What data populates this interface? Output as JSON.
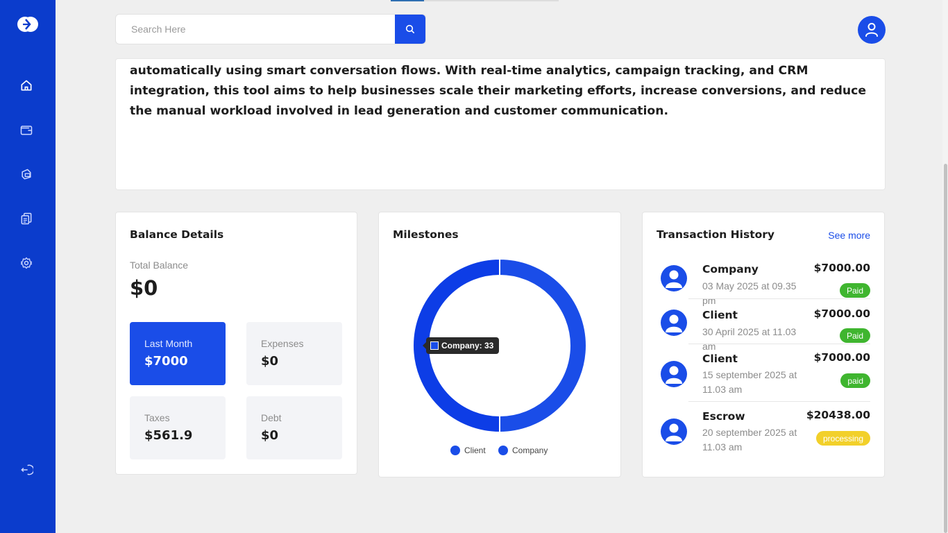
{
  "search": {
    "placeholder": "Search Here",
    "value": ""
  },
  "sidebar": {
    "items": [
      {
        "icon": "home-icon"
      },
      {
        "icon": "wallet-icon"
      },
      {
        "icon": "cards-icon"
      },
      {
        "icon": "documents-icon"
      },
      {
        "icon": "settings-icon"
      }
    ],
    "logout_icon": "logout-icon"
  },
  "description": {
    "text": "automatically using smart conversation flows. With real-time analytics, campaign tracking, and CRM integration, this tool aims to help businesses scale their marketing efforts, increase conversions, and reduce the manual workload involved in lead generation and customer communication."
  },
  "balance": {
    "title": "Balance Details",
    "total_label": "Total Balance",
    "total_value": "$0",
    "tiles": [
      {
        "label": "Last Month",
        "value": "$7000",
        "active": true
      },
      {
        "label": "Expenses",
        "value": "$0"
      },
      {
        "label": "Taxes",
        "value": "$561.9"
      },
      {
        "label": "Debt",
        "value": "$0"
      }
    ]
  },
  "milestones": {
    "title": "Milestones",
    "tooltip": "Company: 33",
    "legend": [
      "Client",
      "Company"
    ]
  },
  "chart_data": {
    "type": "pie",
    "categories": [
      "Client",
      "Company"
    ],
    "values": [
      33,
      33
    ],
    "colors": [
      "#1a4de8",
      "#0d3de6"
    ],
    "legend_position": "bottom"
  },
  "transactions": {
    "title": "Transaction History",
    "see_more": "See more",
    "items": [
      {
        "name": "Company",
        "date": "03 May 2025 at 09.35 pm",
        "amount": "$7000.00",
        "status": "Paid"
      },
      {
        "name": "Client",
        "date": "30 April 2025 at 11.03 am",
        "amount": "$7000.00",
        "status": "Paid"
      },
      {
        "name": "Client",
        "date": "15 september 2025 at 11.03 am",
        "amount": "$7000.00",
        "status": "paid"
      },
      {
        "name": "Escrow",
        "date": "20 september 2025 at 11.03 am",
        "amount": "$20438.00",
        "status": "processing"
      }
    ]
  },
  "colors": {
    "accent": "#1a4de8",
    "sidebar": "#0b3ccc",
    "paid": "#3fb52f",
    "processing": "#f2d02a"
  }
}
